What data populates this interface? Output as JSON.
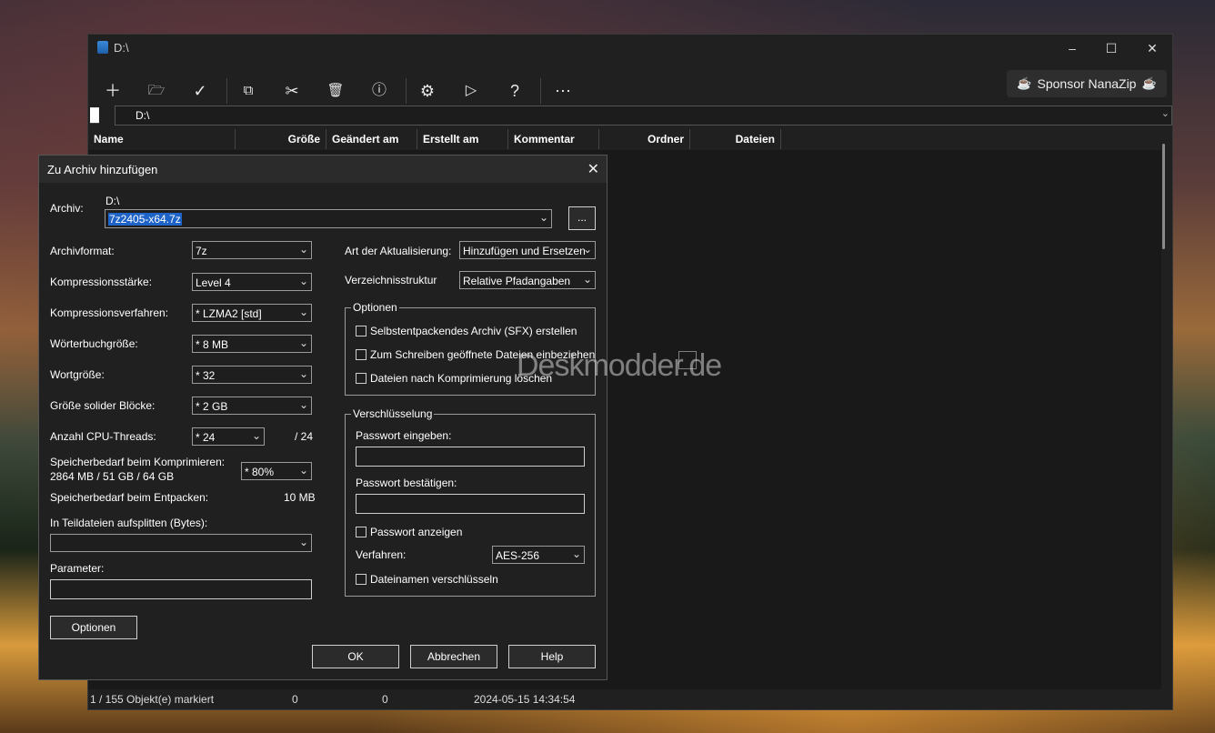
{
  "window": {
    "title": "D:\\"
  },
  "toolbar": {
    "sponsor_label": "Sponsor NanaZip",
    "buttons": [
      "add-icon",
      "folder-add-icon",
      "check-icon",
      "copy-icon",
      "cut-icon",
      "delete-icon",
      "info-icon",
      "gear-icon",
      "play-icon",
      "help-icon",
      "more-icon"
    ]
  },
  "address": {
    "path": "D:\\"
  },
  "columns": [
    "Name",
    "Größe",
    "Geändert am",
    "Erstellt am",
    "Kommentar",
    "Ordner",
    "Dateien"
  ],
  "status": {
    "selection": "1 / 155 Objekt(e) markiert",
    "size": "0",
    "packed": "0",
    "date": "2024-05-15 14:34:54"
  },
  "dialog": {
    "title": "Zu Archiv hinzufügen",
    "archive_label": "Archiv:",
    "archive_dir": "D:\\",
    "archive_name": "7z2405-x64.7z",
    "browse_label": "...",
    "format_label": "Archivformat:",
    "format_value": "7z",
    "level_label": "Kompressionsstärke:",
    "level_value": "Level 4",
    "method_label": "Kompressionsverfahren:",
    "method_value": "*  LZMA2 [std]",
    "dict_label": "Wörterbuchgröße:",
    "dict_value": "*  8 MB",
    "word_label": "Wortgröße:",
    "word_value": "*  32",
    "solid_label": "Größe solider Blöcke:",
    "solid_value": "*  2 GB",
    "threads_label": "Anzahl CPU-Threads:",
    "threads_value": "*  24",
    "threads_max": "/ 24",
    "mem_comp_label": "Speicherbedarf beim Komprimieren:",
    "mem_comp_value": "2864 MB / 51 GB / 64 GB",
    "mem_comp_pct": "* 80%",
    "mem_decomp_label": "Speicherbedarf beim Entpacken:",
    "mem_decomp_value": "10 MB",
    "split_label": "In Teildateien aufsplitten (Bytes):",
    "split_value": "",
    "param_label": "Parameter:",
    "param_value": "",
    "options_button": "Optionen",
    "update_label": "Art der Aktualisierung:",
    "update_value": "Hinzufügen und Ersetzen",
    "path_label": "Verzeichnisstruktur",
    "path_value": "Relative Pfadangaben",
    "options_group": "Optionen",
    "opt_sfx": "Selbstentpackendes Archiv (SFX) erstellen",
    "opt_shared": "Zum Schreiben geöffnete Dateien einbeziehen",
    "opt_delete": "Dateien nach Komprimierung löschen",
    "enc_group": "Verschlüsselung",
    "pw_label": "Passwort eingeben:",
    "pw_confirm_label": "Passwort bestätigen:",
    "show_pw": "Passwort anzeigen",
    "enc_method_label": "Verfahren:",
    "enc_method_value": "AES-256",
    "enc_names": "Dateinamen verschlüsseln",
    "ok": "OK",
    "cancel": "Abbrechen",
    "help": "Help"
  },
  "watermark": "Deskmodder.de"
}
